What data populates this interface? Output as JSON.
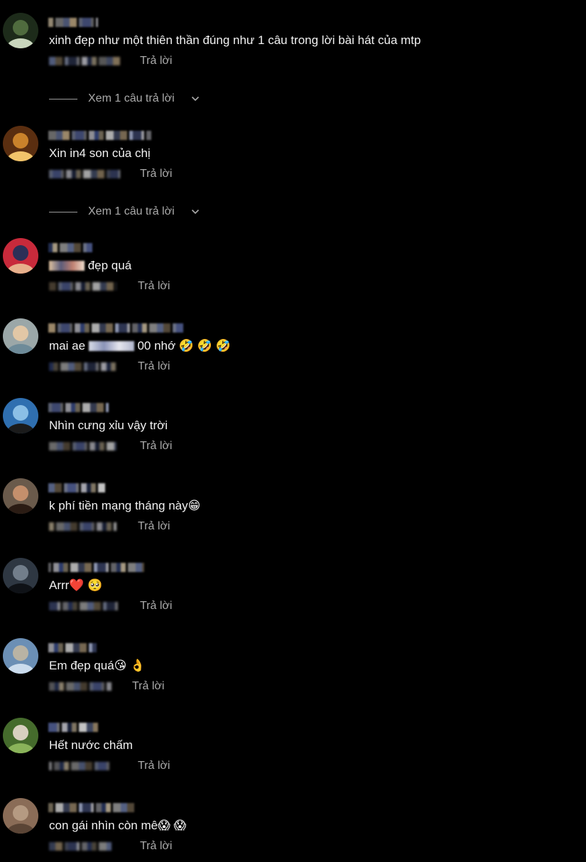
{
  "reply_label": "Trả lời",
  "view_replies_label": "Xem 1 câu trả lời",
  "comments": [
    {
      "text": "xinh đẹp như một thiên thần đúng như 1 câu trong lời bài hát của mtp",
      "view_replies": true,
      "avatar": "plant"
    },
    {
      "text": "Xin in4 son của chị",
      "view_replies": true,
      "avatar": "food"
    },
    {
      "text": " đẹp quá",
      "view_replies": false,
      "avatar": "couple",
      "text_prefix_blur": true
    },
    {
      "text": "mai ae ",
      "text_after": " 00 nhớ 🤣 🤣 🤣",
      "view_replies": false,
      "avatar": "face-light",
      "text_mid_blur": true
    },
    {
      "text": "Nhìn cưng xỉu vậy trời",
      "view_replies": false,
      "avatar": "sunglasses"
    },
    {
      "text": "k phí tiền mạng tháng này😁",
      "view_replies": false,
      "avatar": "man-smile"
    },
    {
      "text": "Arrr❤️ 🥺",
      "view_replies": false,
      "avatar": "car"
    },
    {
      "text": "Em đẹp quá😘 👌",
      "view_replies": false,
      "avatar": "gate"
    },
    {
      "text": "Hết nước chấm",
      "view_replies": false,
      "avatar": "group"
    },
    {
      "text": "con gái nhìn còn mê😱 😱",
      "view_replies": false,
      "avatar": "skin"
    }
  ]
}
